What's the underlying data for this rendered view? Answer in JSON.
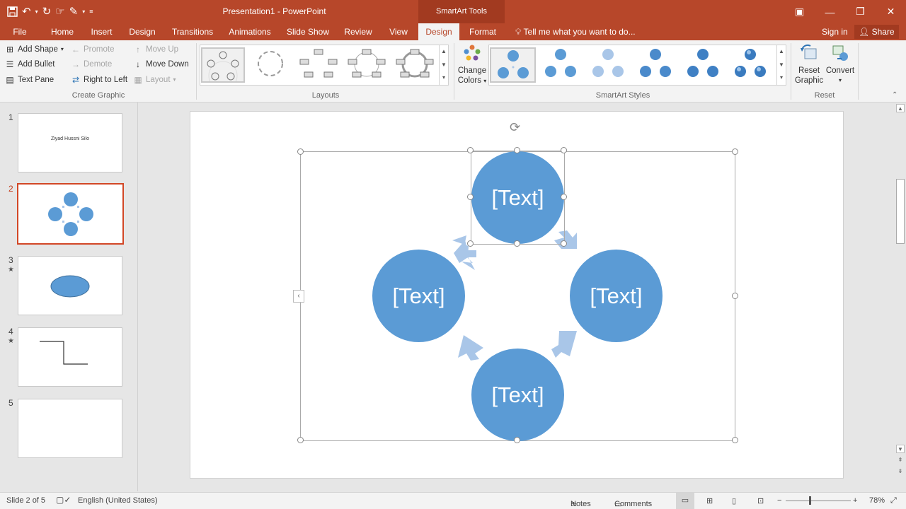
{
  "titlebar": {
    "title": "Presentation1 - PowerPoint",
    "contextual_label": "SmartArt Tools",
    "qat": {
      "save_icon": "save-icon",
      "undo_icon": "undo-icon",
      "redo_icon": "redo-icon"
    }
  },
  "tabs": [
    {
      "label": "File"
    },
    {
      "label": "Home"
    },
    {
      "label": "Insert"
    },
    {
      "label": "Design"
    },
    {
      "label": "Transitions"
    },
    {
      "label": "Animations"
    },
    {
      "label": "Slide Show"
    },
    {
      "label": "Review"
    },
    {
      "label": "View"
    },
    {
      "label": "Design",
      "active": true
    },
    {
      "label": "Format"
    }
  ],
  "tell_me": "Tell me what you want to do...",
  "sign_in": "Sign in",
  "share": "Share",
  "ribbon": {
    "create_graphic": {
      "label": "Create Graphic",
      "add_shape": "Add Shape",
      "add_bullet": "Add Bullet",
      "text_pane": "Text Pane",
      "promote": "Promote",
      "demote": "Demote",
      "right_to_left": "Right to Left",
      "move_up": "Move Up",
      "move_down": "Move Down",
      "layout": "Layout"
    },
    "layouts": {
      "label": "Layouts"
    },
    "smartart_styles": {
      "label": "SmartArt Styles",
      "change_colors_line1": "Change",
      "change_colors_line2": "Colors"
    },
    "reset": {
      "label": "Reset",
      "reset_graphic_line1": "Reset",
      "reset_graphic_line2": "Graphic",
      "convert": "Convert"
    }
  },
  "slides": [
    {
      "num": "1",
      "text": "Ziyad Hussni Silo"
    },
    {
      "num": "2",
      "active": true
    },
    {
      "num": "3",
      "star": "★"
    },
    {
      "num": "4",
      "star": "★"
    },
    {
      "num": "5"
    }
  ],
  "smartart": {
    "top": "[Text]",
    "left": "[Text]",
    "right": "[Text]",
    "bottom": "[Text]"
  },
  "colors": {
    "accent": "#b7472a",
    "shape": "#5b9bd5",
    "arrow": "#a9c6e8"
  },
  "status": {
    "slide": "Slide 2 of 5",
    "language": "English (United States)",
    "notes": "Notes",
    "comments": "Comments",
    "zoom": "78%"
  }
}
